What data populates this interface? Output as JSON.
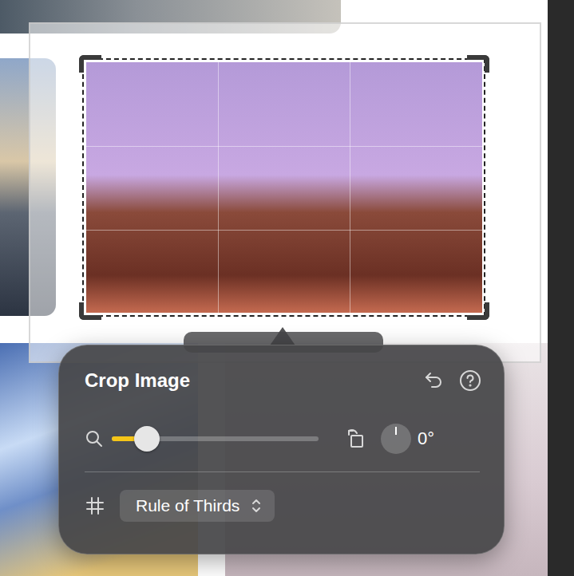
{
  "popover": {
    "title": "Crop Image",
    "zoom": {
      "level": 0.17
    },
    "rotation": {
      "reading": "0°"
    },
    "grid": {
      "label": "Rule of Thirds"
    }
  }
}
